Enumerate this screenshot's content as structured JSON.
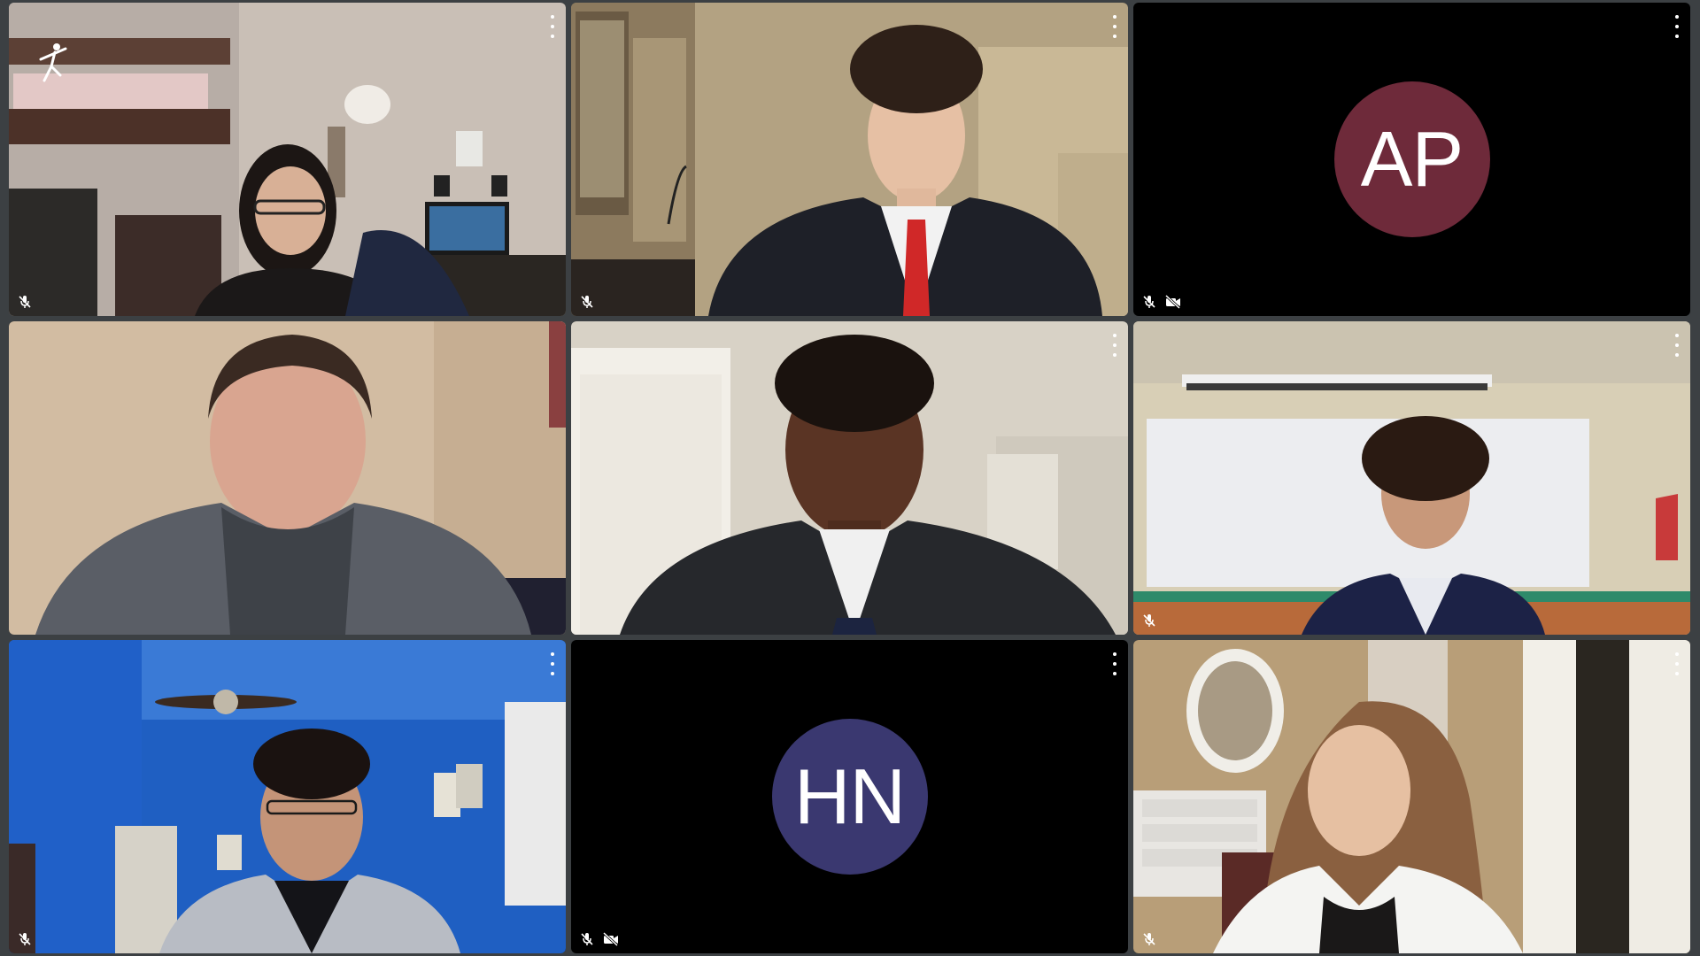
{
  "meeting": {
    "tiles": [
      {
        "id": "t1",
        "type": "video",
        "mic_muted": true,
        "camera_off": false,
        "logo": "app-logo-icon"
      },
      {
        "id": "t2",
        "type": "video",
        "mic_muted": true,
        "camera_off": false
      },
      {
        "id": "t3",
        "type": "avatar",
        "initials": "AP",
        "avatar_color": "#6e2a3a",
        "mic_muted": true,
        "camera_off": true
      },
      {
        "id": "t4",
        "type": "video",
        "mic_muted": false,
        "camera_off": false
      },
      {
        "id": "t5",
        "type": "video",
        "mic_muted": false,
        "camera_off": false
      },
      {
        "id": "t6",
        "type": "video",
        "mic_muted": true,
        "camera_off": false
      },
      {
        "id": "t7",
        "type": "video",
        "mic_muted": true,
        "camera_off": false
      },
      {
        "id": "t8",
        "type": "avatar",
        "initials": "HN",
        "avatar_color": "#3a3870",
        "mic_muted": true,
        "camera_off": true
      },
      {
        "id": "t9",
        "type": "video",
        "mic_muted": true,
        "camera_off": false
      }
    ]
  },
  "icons": {
    "menu": "more-vert-icon",
    "mic_off": "mic-off-icon",
    "cam_off": "videocam-off-icon"
  },
  "colors": {
    "background": "#3c4043",
    "tile_bg": "#000000",
    "indicator": "#ffffff"
  }
}
